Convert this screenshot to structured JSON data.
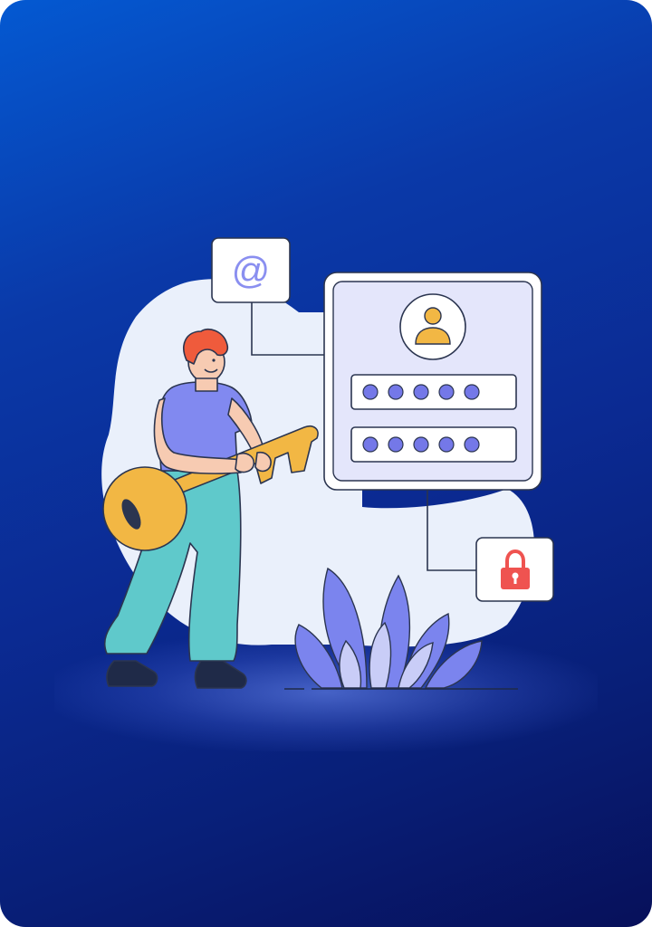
{
  "illustration": {
    "email_symbol": "@",
    "icons": [
      "at-sign-icon",
      "user-avatar-icon",
      "lock-icon",
      "key-icon",
      "plant-icon"
    ],
    "password_mask": [
      "●",
      "●",
      "●",
      "●",
      "●"
    ],
    "colors": {
      "background_top": "#0459d2",
      "background_bottom": "#07105a",
      "blob": "#eaf0fb",
      "key": "#f2b744",
      "shirt": "#8189f0",
      "pants": "#5fc9cb",
      "hair": "#ef5b3c",
      "plant": "#7b84ee",
      "lock": "#ef5350",
      "dot": "#7478e8"
    }
  }
}
